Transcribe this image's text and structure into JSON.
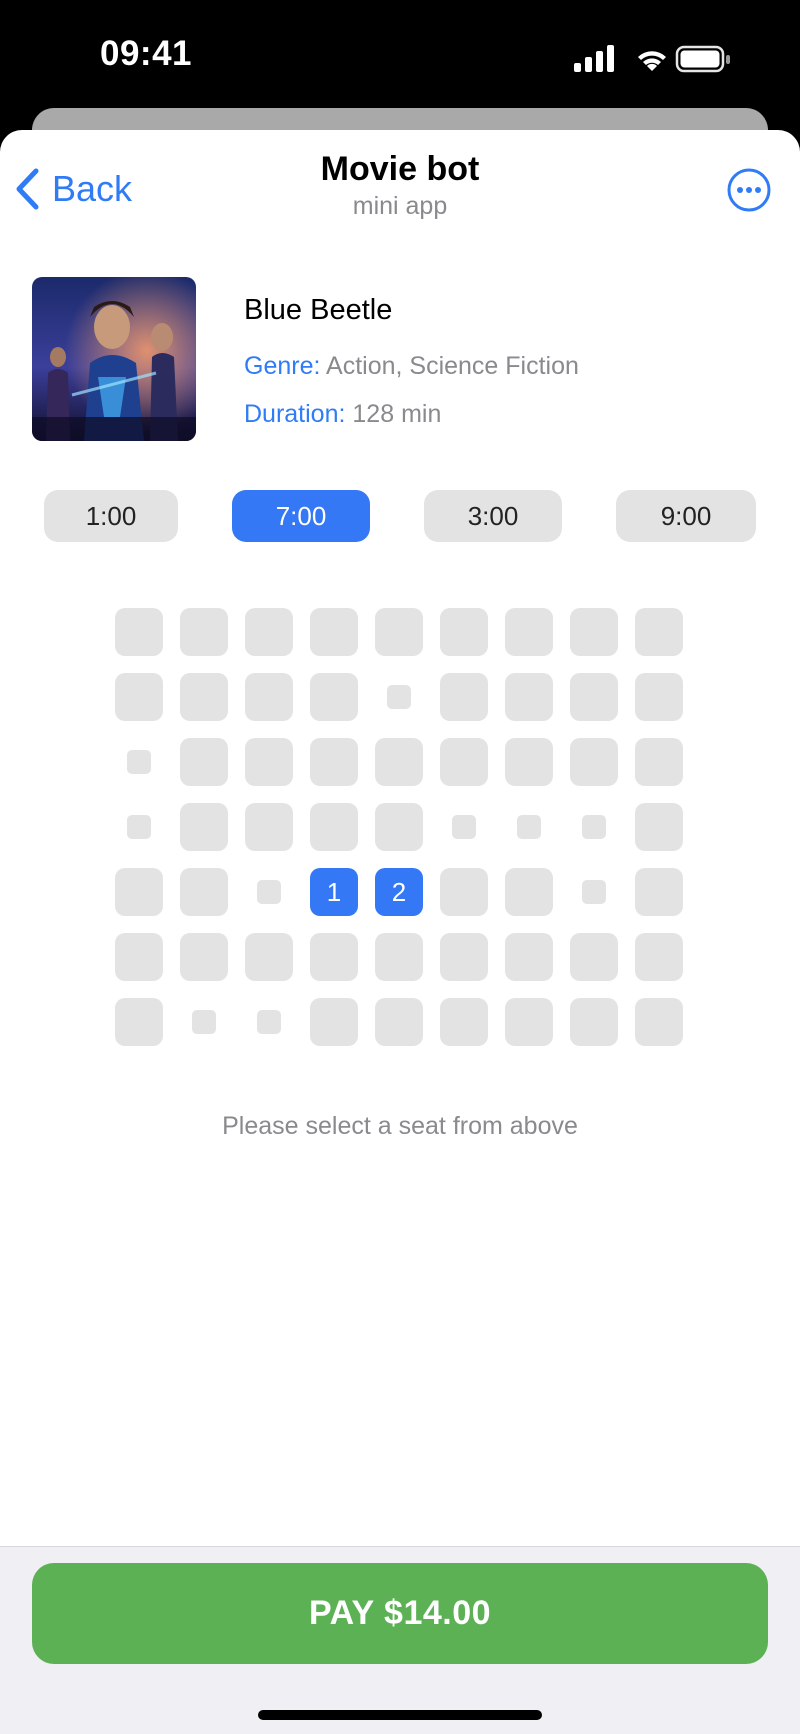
{
  "status_bar": {
    "time": "09:41"
  },
  "nav": {
    "back_label": "Back",
    "title": "Movie bot",
    "subtitle": "mini app",
    "accent_color": "#2f7cf6"
  },
  "movie": {
    "title": "Blue Beetle",
    "genre_label": "Genre:",
    "genre_value": "Action, Science Fiction",
    "duration_label": "Duration:",
    "duration_value": "128 min"
  },
  "showtimes": [
    {
      "label": "1:00",
      "selected": false
    },
    {
      "label": "7:00",
      "selected": true
    },
    {
      "label": "3:00",
      "selected": false
    },
    {
      "label": "9:00",
      "selected": false
    }
  ],
  "seats": {
    "legend": "a = available, t = taken, 1/2 = selected seat number",
    "rows": [
      [
        "a",
        "a",
        "a",
        "a",
        "a",
        "a",
        "a",
        "a",
        "a"
      ],
      [
        "a",
        "a",
        "a",
        "a",
        "t",
        "a",
        "a",
        "a",
        "a"
      ],
      [
        "t",
        "a",
        "a",
        "a",
        "a",
        "a",
        "a",
        "a",
        "a"
      ],
      [
        "t",
        "a",
        "a",
        "a",
        "a",
        "t",
        "t",
        "t",
        "a"
      ],
      [
        "a",
        "a",
        "t",
        "1",
        "2",
        "a",
        "a",
        "t",
        "a"
      ],
      [
        "a",
        "a",
        "a",
        "a",
        "a",
        "a",
        "a",
        "a",
        "a"
      ],
      [
        "a",
        "t",
        "t",
        "a",
        "a",
        "a",
        "a",
        "a",
        "a"
      ]
    ],
    "selected_color": "#3478f6",
    "available_color": "#e3e3e3"
  },
  "hint": "Please select a seat from above",
  "pay_button": {
    "label": "PAY $14.00",
    "color": "#5db155"
  }
}
